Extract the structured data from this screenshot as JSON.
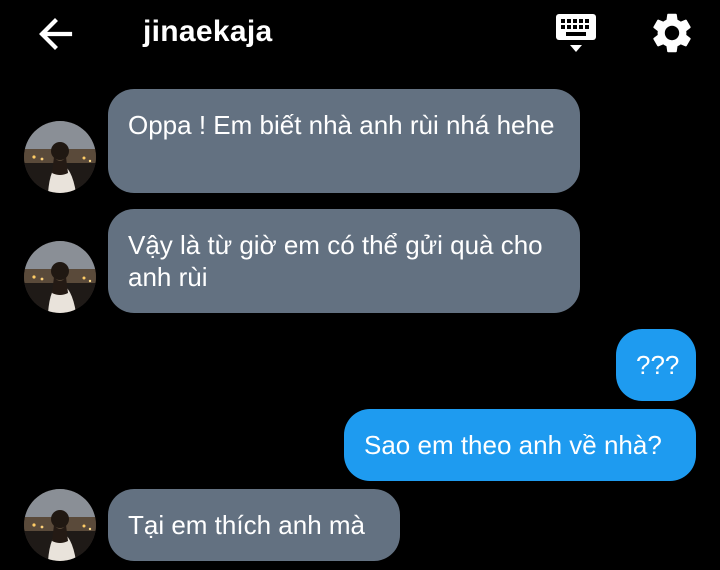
{
  "header": {
    "back_icon": "arrow-left-icon",
    "title": "jinaekaja",
    "keyboard_icon": "keyboard-icon",
    "settings_icon": "gear-icon"
  },
  "colors": {
    "background": "#000000",
    "incoming_bubble": "#637181",
    "outgoing_bubble": "#1e9bf0",
    "text": "#ffffff"
  },
  "messages": [
    {
      "sender": "contact",
      "text": "Oppa ! Em biết nhà anh rùi nhá hehe"
    },
    {
      "sender": "contact",
      "text": "Vậy là từ giờ em có thể gửi quà cho anh rùi"
    },
    {
      "sender": "me",
      "text": "???"
    },
    {
      "sender": "me",
      "text": "Sao em theo anh về nhà?"
    },
    {
      "sender": "contact",
      "text": "Tại em thích anh mà"
    }
  ]
}
